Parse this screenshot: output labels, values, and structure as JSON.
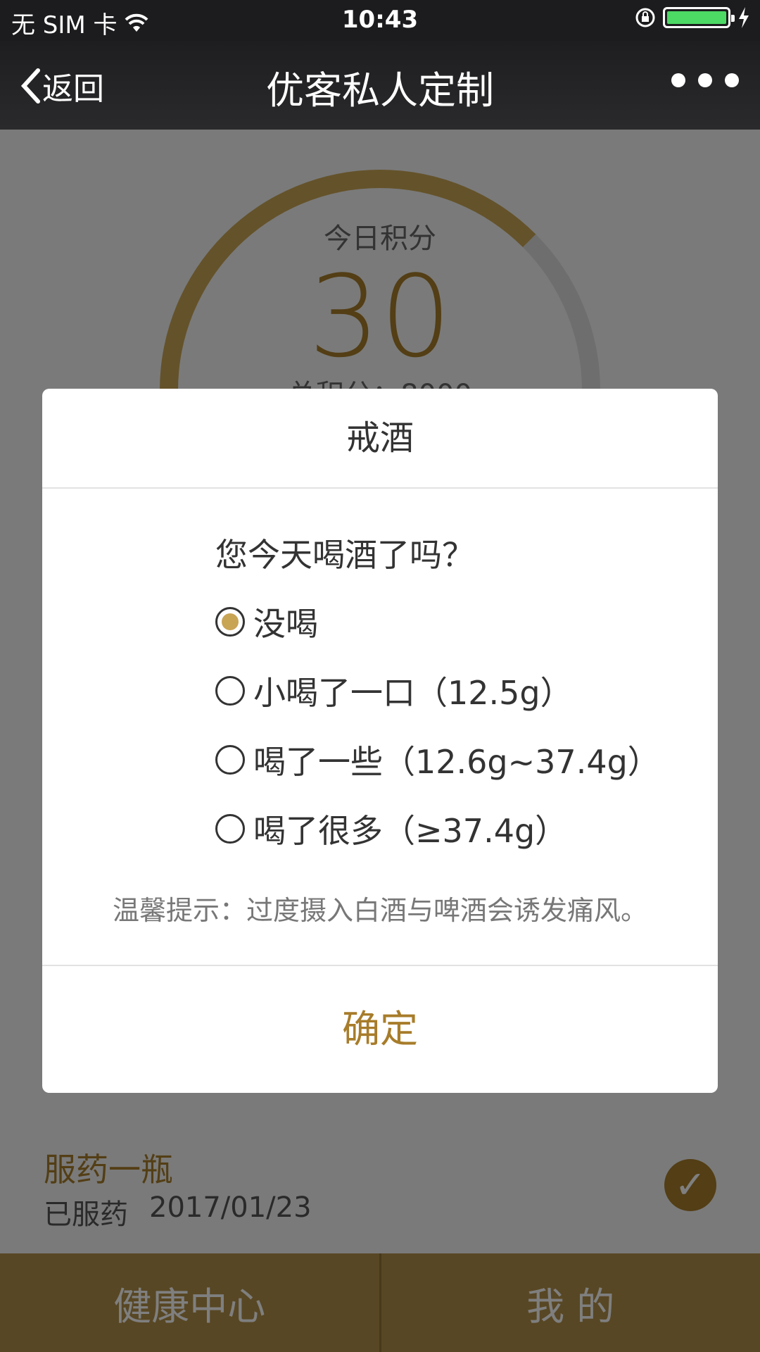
{
  "status_bar": {
    "carrier": "无 SIM 卡",
    "wifi_icon": "wifi-icon",
    "time": "10:43",
    "lock_icon": "orientation-lock-icon",
    "battery_icon": "battery-icon",
    "charging_icon": "charging-bolt-icon"
  },
  "nav": {
    "back_label": "返回",
    "title": "优客私人定制",
    "more_icon": "more-dots-icon"
  },
  "score": {
    "label": "今日积分",
    "value": "30",
    "total": "总积分：8000"
  },
  "dialog": {
    "title": "戒酒",
    "question": "您今天喝酒了吗？",
    "options": [
      {
        "label": "没喝",
        "selected": true
      },
      {
        "label": "小喝了一口（12.5g）",
        "selected": false
      },
      {
        "label": "喝了一些（12.6g~37.4g）",
        "selected": false
      },
      {
        "label": "喝了很多（≥37.4g）",
        "selected": false
      }
    ],
    "tip": "温馨提示：过度摄入白酒与啤酒会诱发痛风。",
    "confirm_label": "确定"
  },
  "medication": {
    "title": "服药一瓶",
    "status": "已服药",
    "date": "2017/01/23",
    "check_icon": "checkmark-icon"
  },
  "tabs": [
    {
      "label": "健康中心"
    },
    {
      "label": "我 的"
    }
  ],
  "colors": {
    "accent": "#a77c2a",
    "radio_fill": "#c8a455",
    "tabbar": "#b08e48"
  }
}
